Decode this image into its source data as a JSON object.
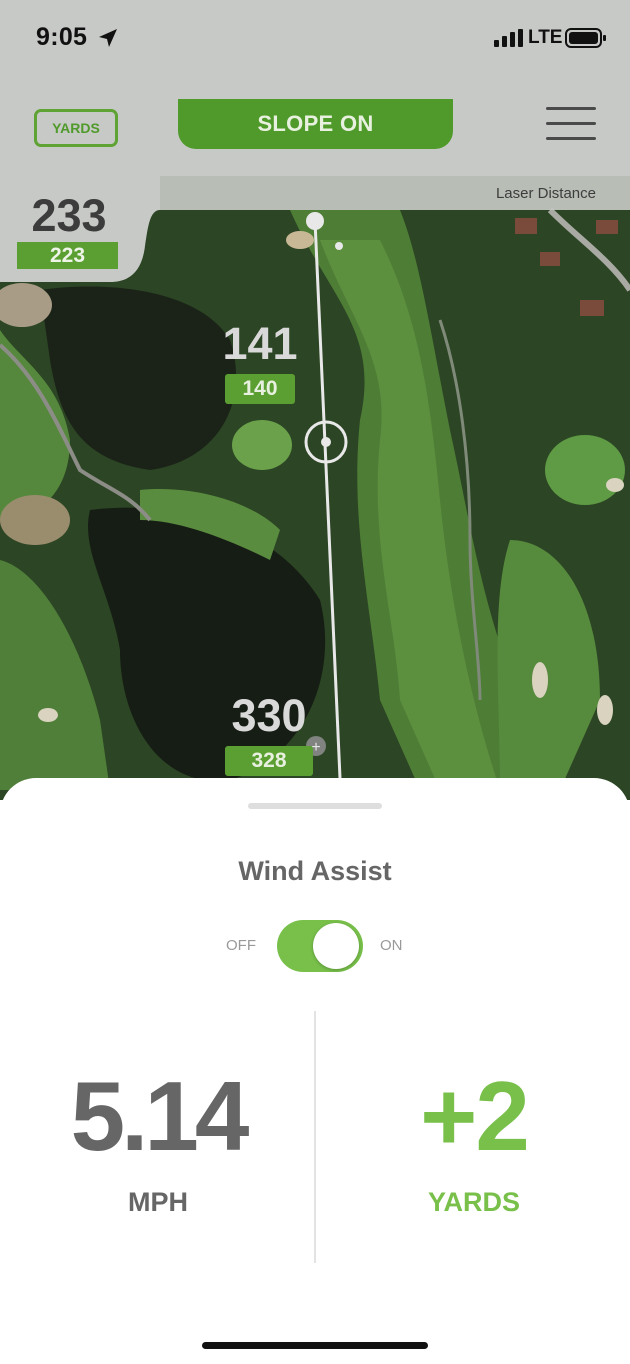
{
  "status_bar": {
    "time": "9:05",
    "network": "LTE"
  },
  "header": {
    "units_label": "YARDS",
    "slope_label": "SLOPE ON",
    "laser_label": "Laser Distance"
  },
  "distances": {
    "pin": {
      "distance": "233",
      "adjusted": "223"
    },
    "target": {
      "distance": "141",
      "adjusted": "140"
    },
    "tee": {
      "distance": "330",
      "adjusted": "328"
    }
  },
  "wind_panel": {
    "title": "Wind Assist",
    "off_label": "OFF",
    "on_label": "ON",
    "toggle_on": true,
    "wind_speed": "5.14",
    "wind_unit": "MPH",
    "adjustment": "+2",
    "adjustment_unit": "YARDS"
  },
  "colors": {
    "accent": "#5b9f33",
    "toggle": "#78c04a",
    "text_gray": "#666666"
  }
}
